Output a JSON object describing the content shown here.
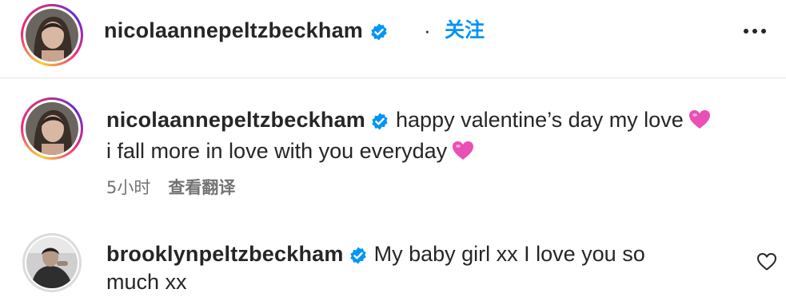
{
  "post_header": {
    "username": "nicolaannepeltzbeckham",
    "separator": "·",
    "follow_label": "关注",
    "more_icon": "more-horizontal-icon",
    "verified_icon": "verified-badge-icon"
  },
  "comments": [
    {
      "username": "nicolaannepeltzbeckham",
      "verified": true,
      "line1": "happy valentine’s day my love",
      "line2": "i fall more in love with you everyday",
      "emoji": "pink-heart-icon",
      "timestamp": "5小时",
      "translate_label": "查看翻译"
    },
    {
      "username": "brooklynpeltzbeckham",
      "verified": true,
      "line1": "My baby girl xx I love you so",
      "line2": "much xx",
      "like_icon": "heart-outline-icon"
    }
  ],
  "colors": {
    "accent": "#0095f6",
    "text": "#262626",
    "secondary_text": "#737373",
    "verified_badge": "#0095f6",
    "emoji_pink": "#e94fb4"
  }
}
